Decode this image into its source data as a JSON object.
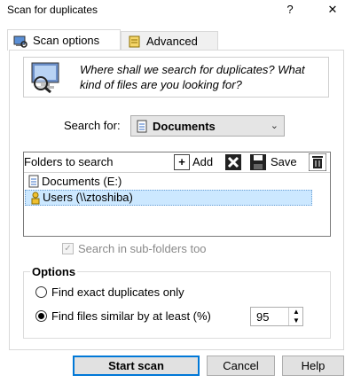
{
  "window": {
    "title": "Scan for duplicates",
    "help_glyph": "?",
    "close_glyph": "✕"
  },
  "tabs": [
    {
      "label": "Scan options",
      "active": true
    },
    {
      "label": "Advanced",
      "active": false
    }
  ],
  "info": {
    "text": "Where shall we search for duplicates? What kind of files are you looking for?"
  },
  "search_for": {
    "label": "Search for:",
    "selected": "Documents"
  },
  "folders": {
    "title": "Folders to search",
    "add_label": "Add",
    "save_label": "Save",
    "items": [
      {
        "label": "Documents (E:)",
        "selected": false
      },
      {
        "label": "Users (\\\\ztoshiba)",
        "selected": true
      }
    ]
  },
  "subfolders": {
    "label": "Search in sub-folders too",
    "checked": true,
    "enabled": false
  },
  "options": {
    "title": "Options",
    "exact_label": "Find exact duplicates only",
    "similar_label": "Find files similar by at least (%)",
    "similar_selected": true,
    "similarity_value": "95"
  },
  "buttons": {
    "start": "Start scan",
    "cancel": "Cancel",
    "help": "Help"
  },
  "colors": {
    "accent": "#0078d7",
    "selection_bg": "#cce8ff"
  }
}
